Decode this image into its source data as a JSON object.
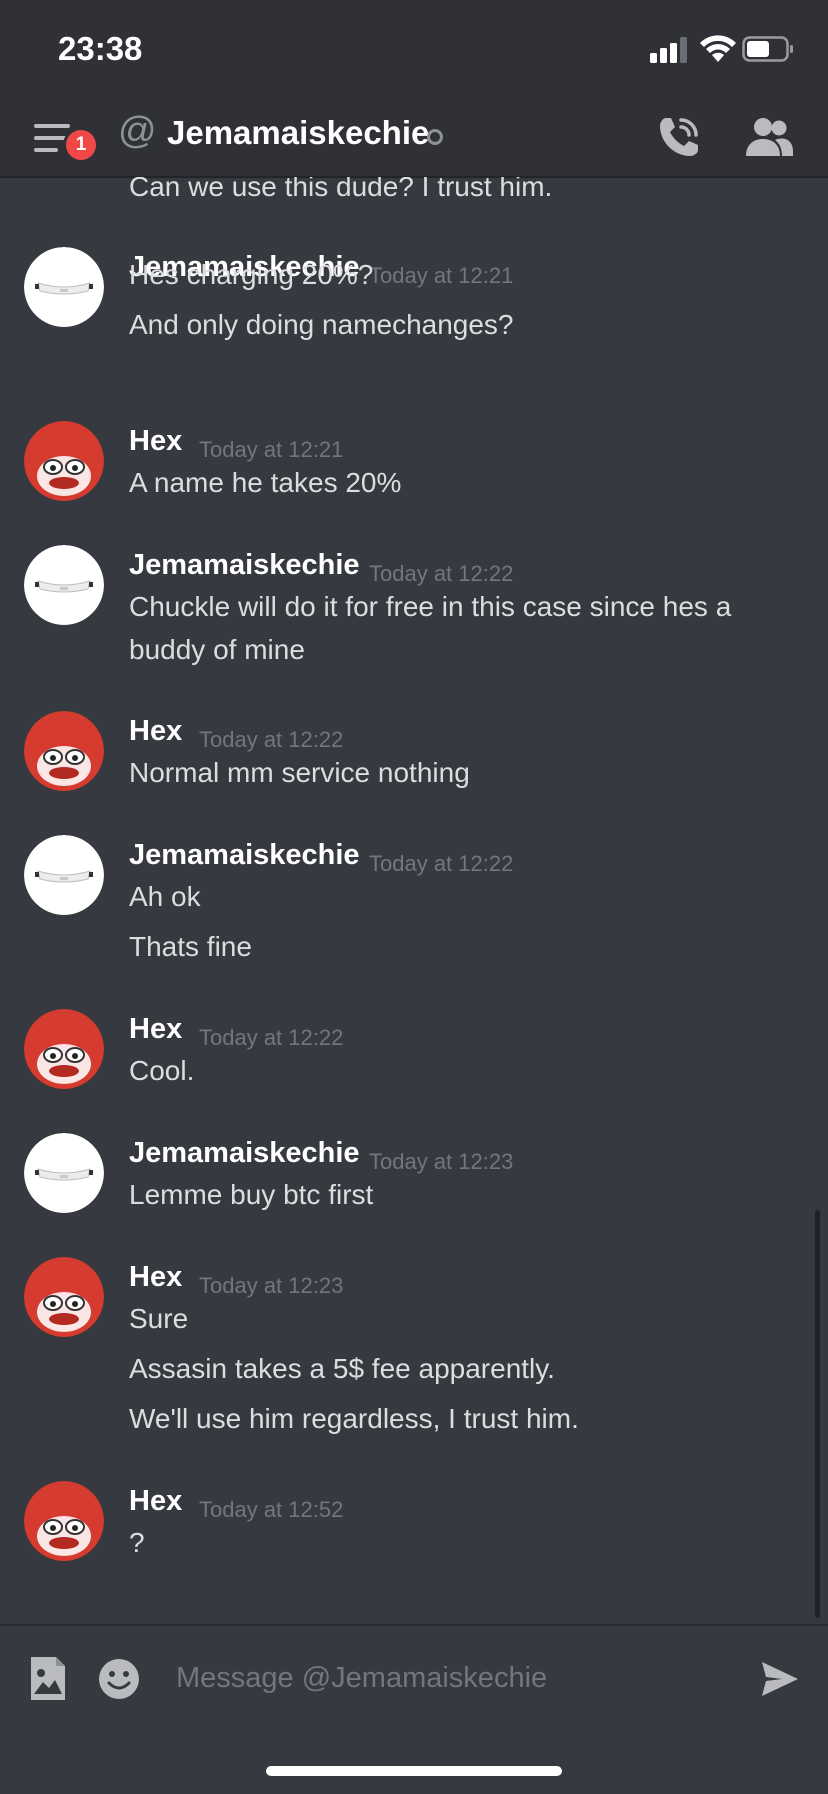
{
  "status_bar": {
    "time": "23:38"
  },
  "header": {
    "notification_count": "1",
    "at_symbol": "@",
    "channel_name": "Jemamaiskechie"
  },
  "messages": {
    "partial_top": "Can we use this dude? I trust him.",
    "groups": [
      {
        "author": "Jemamaiskechie",
        "timestamp": "Today at 12:21",
        "lines": [
          "Hes charging 20%?",
          "And only doing namechanges?"
        ]
      },
      {
        "author": "Hex",
        "timestamp": "Today at 12:21",
        "lines": [
          "A name he takes 20%"
        ]
      },
      {
        "author": "Jemamaiskechie",
        "timestamp": "Today at 12:22",
        "lines": [
          "Chuckle will do it for free in this case since hes a",
          "buddy of mine"
        ]
      },
      {
        "author": "Hex",
        "timestamp": "Today at 12:22",
        "lines": [
          "Normal mm service nothing"
        ]
      },
      {
        "author": "Jemamaiskechie",
        "timestamp": "Today at 12:22",
        "lines": [
          "Ah ok",
          "Thats fine"
        ]
      },
      {
        "author": "Hex",
        "timestamp": "Today at 12:22",
        "lines": [
          "Cool."
        ]
      },
      {
        "author": "Jemamaiskechie",
        "timestamp": "Today at 12:23",
        "lines": [
          "Lemme buy btc first"
        ]
      },
      {
        "author": "Hex",
        "timestamp": "Today at 12:23",
        "lines": [
          "Sure",
          "Assasin takes a 5$ fee apparently.",
          "We'll use him regardless, I trust him."
        ]
      },
      {
        "author": "Hex",
        "timestamp": "Today at 12:52",
        "lines": [
          "?"
        ]
      }
    ]
  },
  "composer": {
    "placeholder": "Message @Jemamaiskechie"
  },
  "colors": {
    "background": "#36393f",
    "header": "#2f3136",
    "badge": "#f04747",
    "timestamp": "#72767d",
    "text": "#dcddde"
  }
}
